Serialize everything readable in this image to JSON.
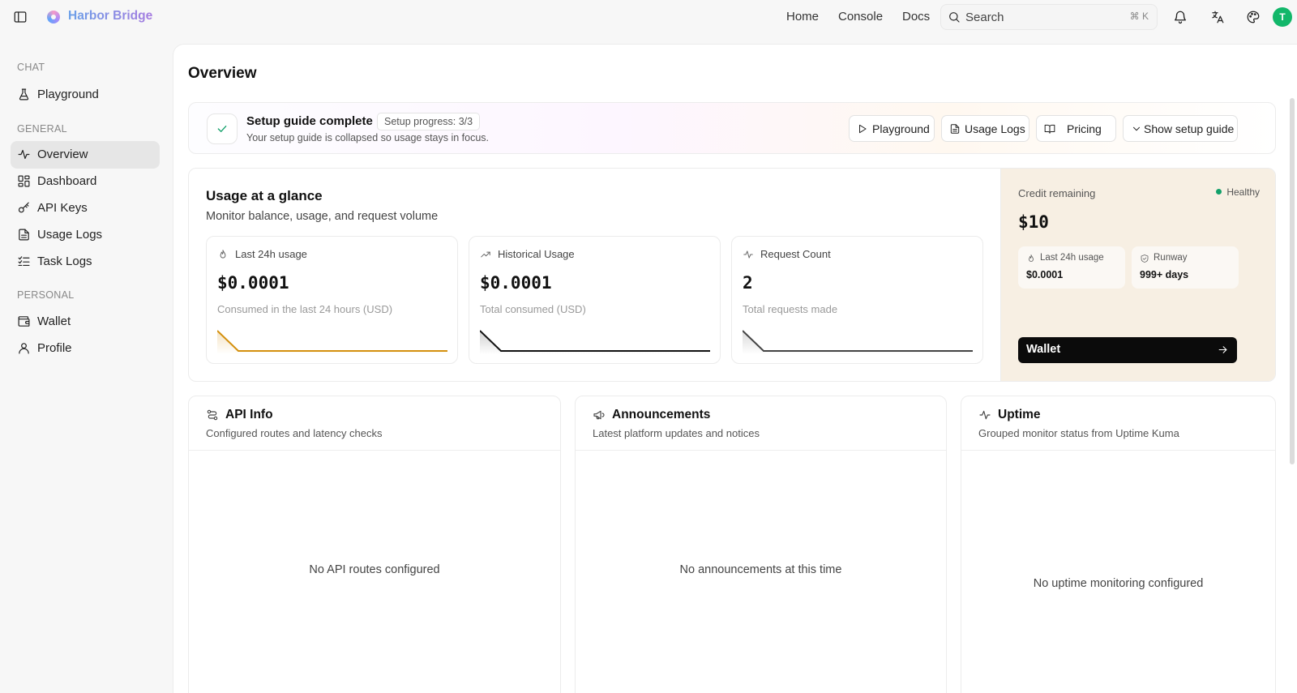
{
  "brand": {
    "name": "Harbor Bridge"
  },
  "topnav": [
    {
      "label": "Home"
    },
    {
      "label": "Console"
    },
    {
      "label": "Docs"
    }
  ],
  "search": {
    "placeholder": "Search",
    "shortcut": "⌘ K"
  },
  "user": {
    "initial": "T"
  },
  "sidebar": {
    "sections": [
      {
        "label": "CHAT"
      },
      {
        "label": "GENERAL"
      },
      {
        "label": "PERSONAL"
      }
    ],
    "items": [
      {
        "label": "Playground",
        "icon": "flask-icon"
      },
      {
        "label": "Overview",
        "icon": "activity-icon",
        "active": true
      },
      {
        "label": "Dashboard",
        "icon": "dashboard-icon"
      },
      {
        "label": "API Keys",
        "icon": "key-icon"
      },
      {
        "label": "Usage Logs",
        "icon": "file-text-icon"
      },
      {
        "label": "Task Logs",
        "icon": "list-checks-icon"
      },
      {
        "label": "Wallet",
        "icon": "wallet-icon"
      },
      {
        "label": "Profile",
        "icon": "user-icon"
      }
    ]
  },
  "page": {
    "title": "Overview"
  },
  "setup": {
    "title": "Setup guide complete",
    "progress": "Setup progress: 3/3",
    "description": "Your setup guide is collapsed so usage stays in focus.",
    "buttons": [
      {
        "label": "Playground",
        "icon": "play-icon"
      },
      {
        "label": "Usage Logs",
        "icon": "file-text-icon"
      },
      {
        "label": "Pricing",
        "icon": "book-open-icon"
      },
      {
        "label": "Show setup guide",
        "icon": "chevron-down-icon"
      }
    ]
  },
  "usage": {
    "title": "Usage at a glance",
    "subtitle": "Monitor balance, usage, and request volume",
    "metrics": [
      {
        "label": "Last 24h usage",
        "value": "$0.0001",
        "description": "Consumed in the last 24 hours (USD)",
        "color": "#d4900e"
      },
      {
        "label": "Historical Usage",
        "value": "$0.0001",
        "description": "Total consumed (USD)",
        "color": "#111111"
      },
      {
        "label": "Request Count",
        "value": "2",
        "description": "Total requests made",
        "color": "#444444"
      }
    ]
  },
  "credit": {
    "label": "Credit remaining",
    "status": "Healthy",
    "amount": "$10",
    "last24": {
      "label": "Last 24h usage",
      "value": "$0.0001"
    },
    "runway": {
      "label": "Runway",
      "value": "999+ days"
    },
    "wallet_button": "Wallet"
  },
  "panels": {
    "api_info": {
      "title": "API Info",
      "description": "Configured routes and latency checks",
      "empty": "No API routes configured"
    },
    "announcements": {
      "title": "Announcements",
      "description": "Latest platform updates and notices",
      "empty": "No announcements at this time"
    },
    "uptime": {
      "title": "Uptime",
      "description": "Grouped monitor status from Uptime Kuma",
      "empty": "No uptime monitoring configured"
    }
  },
  "colors": {
    "accent": "#12b76a",
    "healthy": "#12a06a",
    "credit_bg": "#f7efe3"
  }
}
